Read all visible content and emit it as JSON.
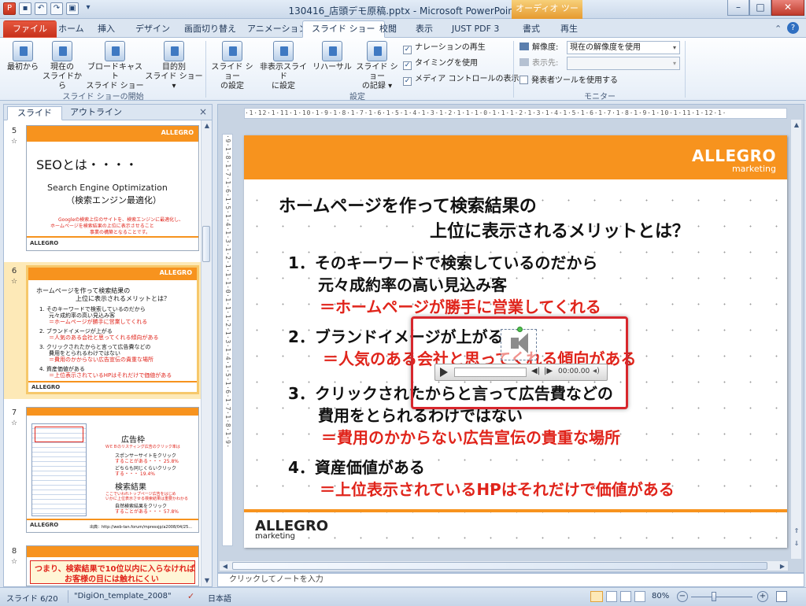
{
  "window": {
    "title": "130416_店頭デモ原稿.pptx - Microsoft PowerPoint",
    "context_tab": "オーディオ ツール"
  },
  "tabs": [
    "ファイル",
    "ホーム",
    "挿入",
    "デザイン",
    "画面切り替え",
    "アニメーション",
    "スライド ショー",
    "校閲",
    "表示",
    "JUST PDF 3",
    "書式",
    "再生"
  ],
  "ribbon": {
    "group1": {
      "label": "スライド ショーの開始",
      "buttons": [
        {
          "line1": "最初から",
          "line2": ""
        },
        {
          "line1": "現在の",
          "line2": "スライドから"
        },
        {
          "line1": "ブロードキャスト",
          "line2": "スライド ショー"
        },
        {
          "line1": "目的別",
          "line2": "スライド ショー ▾"
        }
      ]
    },
    "group2": {
      "label": "設定",
      "buttons": [
        {
          "line1": "スライド ショー",
          "line2": "の設定"
        },
        {
          "line1": "非表示スライド",
          "line2": "に設定"
        },
        {
          "line1": "リハーサル",
          "line2": ""
        },
        {
          "line1": "スライド ショー",
          "line2": "の記録 ▾"
        }
      ],
      "checks": [
        {
          "label": "ナレーションの再生",
          "checked": "✓"
        },
        {
          "label": "タイミングを使用",
          "checked": "✓"
        },
        {
          "label": "メディア コントロールの表示",
          "checked": "✓"
        }
      ]
    },
    "group3": {
      "label": "モニター",
      "resolution_label": "解像度:",
      "resolution_value": "現在の解像度を使用",
      "display_label": "表示先:",
      "presenter_label": "発表者ツールを使用する"
    }
  },
  "panel": {
    "tabs": [
      "スライド",
      "アウトライン"
    ],
    "close": "×",
    "thumbs": [
      {
        "num": "5",
        "logo": "ALLEGRO",
        "title": "SEOとは・・・・",
        "sub1": "Search Engine Optimization",
        "sub2": "（検索エンジン最適化）",
        "r1": "Googleの検索上位のサイトを、検索エンジンに最適化し、",
        "r2": "ホームページを検索結果の上位に表示させること",
        "r3": "事業の構築となることです。",
        "foot": "ALLEGRO"
      },
      {
        "num": "6",
        "logo": "ALLEGRO",
        "h1": "ホームページを作って検索結果の",
        "h2": "上位に表示されるメリットとは？",
        "i1": "1. そのキーワードで検索しているのだから",
        "i1b": "元々成約率の高い見込み客",
        "i1r": "＝ホームページが勝手に営業してくれる",
        "i2": "2. ブランドイメージが上がる",
        "i2r": "＝人気のある会社と思ってくれる傾向がある",
        "i3": "3. クリックされたからと言って広告費などの",
        "i3b": "費用をとられるわけではない",
        "i3r": "＝費用のかからない広告宣伝の貴重な場所",
        "i4": "4. 資産価値がある",
        "i4r": "＝上位表示されているHPはそれだけで価値がある",
        "foot": "ALLEGRO"
      },
      {
        "num": "7",
        "label1": "広告枠",
        "t1": "ＷＥＢのリスティング広告のクリック率は",
        "t2": "スポンサーサイトをクリック",
        "t3": "することがある・・・ 25.8%",
        "t4": "どちらも同じくらいクリック",
        "t5": "する・・・ 19.4%",
        "label2": "検索結果",
        "t6": "ここでいわれトップページ広告をはじめ",
        "t7": "いかに上位表示させる検索結果は重要かわかる",
        "t8": "自然検索結果をクリック",
        "t9": "することがある・・・ 57.8%",
        "foot": "ALLEGRO",
        "src": "出典：http://web-tan.forum/mpressjp/a2008/04/25..."
      },
      {
        "num": "8",
        "r1": "つまり、検索結果で10位以内に入らなければ",
        "r2": "お客様の目には触れにくい"
      }
    ]
  },
  "ruler": {
    "h": "·1·12·1·11·1·10·1·9·1·8·1·7·1·6·1·5·1·4·1·3·1·2·1·1·1·0·1·1·1·2·1·3·1·4·1·5·1·6·1·7·1·8·1·9·1·10·1·11·1·12·1·",
    "v": "·9·1·8·1·7·1·6·1·5·1·4·1·3·1·2·1·1·1·0·1·1·1·2·1·3·1·4·1·5·1·6·1·7·1·8·1·9·"
  },
  "slide": {
    "logo": "ALLEGRO",
    "logo_sub": "marketing",
    "title1": "ホームページを作って検索結果の",
    "title2": "上位に表示されるメリットとは？",
    "items": [
      {
        "head": "1．そのキーワードで検索しているのだから",
        "sub": "元々成約率の高い見込み客",
        "red": "＝ホームページが勝手に営業してくれる"
      },
      {
        "head": "2．ブランドイメージが上がる",
        "sub": "",
        "red": "＝人気のある会社と思ってくれる傾向がある"
      },
      {
        "head": "3．クリックされたからと言って広告費などの",
        "sub": "費用をとられるわけではない",
        "red": "＝費用のかからない広告宣伝の貴重な場所"
      },
      {
        "head": "4．資産価値がある",
        "sub": "",
        "red": "＝上位表示されているHPはそれだけで価値がある"
      }
    ],
    "footer_logo": "ALLEGRO",
    "footer_sub": "marketing",
    "media_time": "00:00.00"
  },
  "notes_placeholder": "クリックしてノートを入力",
  "status": {
    "slide": "スライド 6/20",
    "theme": "\"DigiOn_template_2008\"",
    "lang": "日本語",
    "zoom": "80%"
  }
}
